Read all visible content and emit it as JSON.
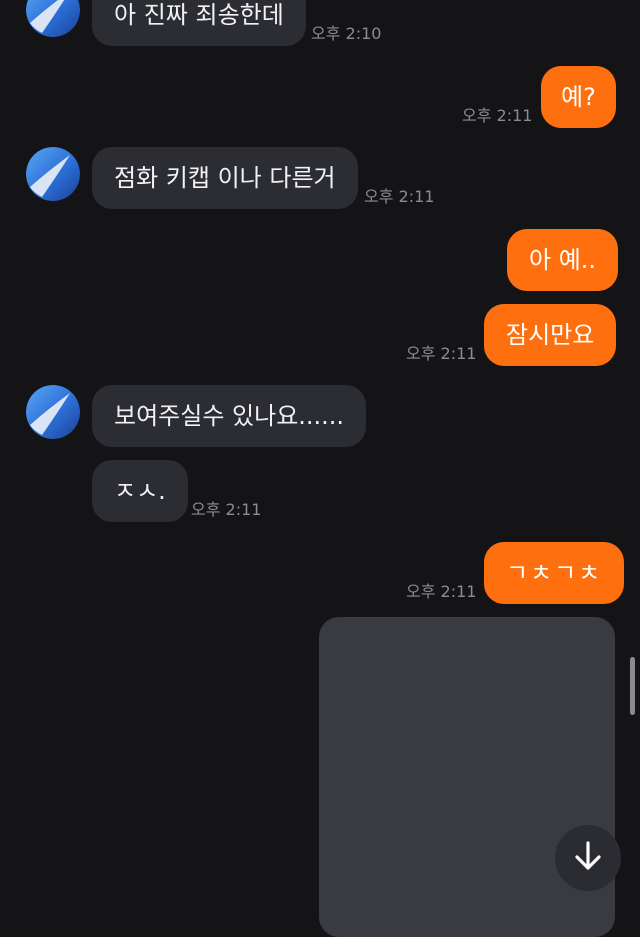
{
  "messages": [
    {
      "side": "in",
      "text": "아 진짜 죄송한데",
      "time": "오후 2:10"
    },
    {
      "side": "out",
      "text": "예?",
      "time": "오후 2:11"
    },
    {
      "side": "in",
      "text": "점화 키캡 이나 다른거",
      "time": "오후 2:11"
    },
    {
      "side": "out",
      "text": "아 예..",
      "time": ""
    },
    {
      "side": "out",
      "text": "잠시만요",
      "time": "오후 2:11"
    },
    {
      "side": "in",
      "text": "보여주실수 있나요......",
      "time": ""
    },
    {
      "side": "in",
      "text": "ㅈㅅ.",
      "time": "오후 2:11"
    },
    {
      "side": "out",
      "text": "ㄱㅊㄱㅊ",
      "time": "오후 2:11"
    },
    {
      "side": "out",
      "text": "",
      "type": "photo",
      "time": ""
    }
  ],
  "colors": {
    "background": "#141417",
    "incoming_bubble": "#2b2d33",
    "outgoing_bubble": "#fe6f10",
    "timestamp": "#8b8c92"
  },
  "icons": {
    "avatar": "gradient-sphere-avatar",
    "scroll_down": "arrow-down-icon"
  }
}
